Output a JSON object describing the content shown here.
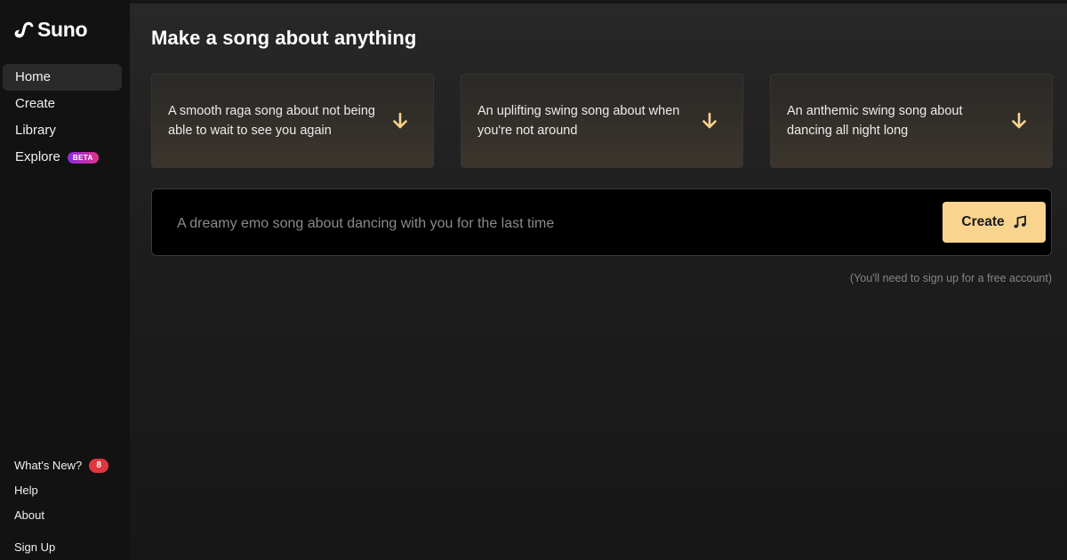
{
  "app": {
    "brand": "Suno",
    "accent_color": "#f8d48f",
    "icons": {
      "logo": "suno-logo-icon",
      "suggestion_arrow": "arrow-down-icon",
      "create": "music-note-icon"
    }
  },
  "sidebar": {
    "nav": [
      {
        "label": "Home",
        "active": true
      },
      {
        "label": "Create",
        "active": false
      },
      {
        "label": "Library",
        "active": false
      },
      {
        "label": "Explore",
        "active": false,
        "badge": "BETA"
      }
    ],
    "bottom": [
      {
        "label": "What's New?",
        "badge": "8"
      },
      {
        "label": "Help"
      },
      {
        "label": "About"
      },
      {
        "label": "Sign Up"
      }
    ]
  },
  "main": {
    "title": "Make a song about anything",
    "suggestions": [
      {
        "text": "A smooth raga song about not being able to wait to see you again"
      },
      {
        "text": "An uplifting swing song about when you're not around"
      },
      {
        "text": "An anthemic swing song about dancing all night long"
      }
    ],
    "prompt": {
      "placeholder": "A dreamy emo song about dancing with you for the last time",
      "value": ""
    },
    "create_label": "Create",
    "signup_note": "(You'll need to sign up for a free account)"
  }
}
